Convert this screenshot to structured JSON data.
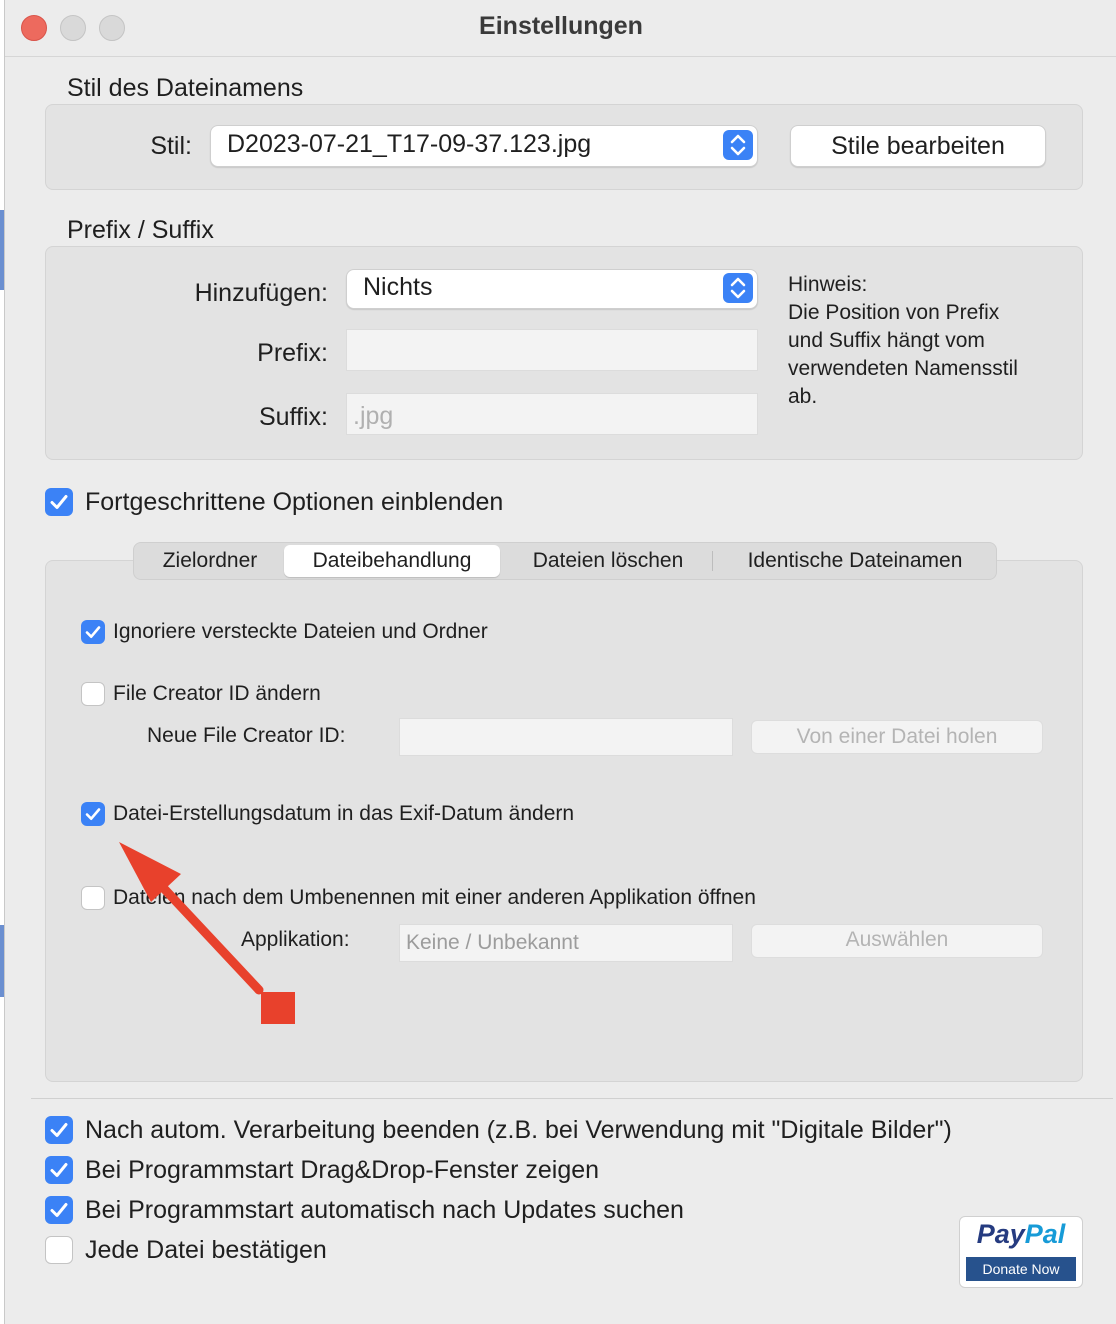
{
  "window": {
    "title": "Einstellungen"
  },
  "style_section": {
    "title": "Stil des Dateinamens",
    "label": "Stil:",
    "value": "D2023-07-21_T17-09-37.123.jpg",
    "edit_button": "Stile bearbeiten"
  },
  "prefix_section": {
    "title": "Prefix / Suffix",
    "add_label": "Hinzufügen:",
    "add_value": "Nichts",
    "prefix_label": "Prefix:",
    "prefix_value": "",
    "suffix_label": "Suffix:",
    "suffix_placeholder": ".jpg",
    "hint_title": "Hinweis:",
    "hint_lines": [
      "Die Position von Prefix",
      "und Suffix hängt vom",
      "verwendeten Namensstil",
      "ab."
    ]
  },
  "advanced": {
    "label": "Fortgeschrittene Optionen einblenden",
    "checked": true
  },
  "tabs": [
    {
      "label": "Zielordner",
      "selected": false
    },
    {
      "label": "Dateibehandlung",
      "selected": true
    },
    {
      "label": "Dateien löschen",
      "selected": false
    },
    {
      "label": "Identische Dateinamen",
      "selected": false
    }
  ],
  "file_handling": {
    "ignore_hidden": {
      "label": "Ignoriere versteckte Dateien und Ordner",
      "checked": true
    },
    "creator_id": {
      "label": "File Creator ID ändern",
      "checked": false
    },
    "new_creator_label": "Neue File Creator ID:",
    "new_creator_value": "",
    "from_file_button": "Von einer Datei holen",
    "exif_date": {
      "label": "Datei-Erstellungsdatum in das Exif-Datum ändern",
      "checked": true
    },
    "open_with": {
      "label": "Dateien nach dem Umbenennen mit einer anderen Applikation öffnen",
      "checked": false
    },
    "app_label": "Applikation:",
    "app_value": "Keine / Unbekannt",
    "choose_button": "Auswählen"
  },
  "bottom_options": [
    {
      "label": "Nach autom. Verarbeitung beenden (z.B. bei Verwendung mit \"Digitale Bilder\")",
      "checked": true
    },
    {
      "label": "Bei Programmstart Drag&Drop-Fenster zeigen",
      "checked": true
    },
    {
      "label": "Bei Programmstart automatisch nach Updates suchen",
      "checked": true
    },
    {
      "label": "Jede Datei bestätigen",
      "checked": false
    }
  ],
  "paypal": {
    "logo_pay": "Pay",
    "logo_pal": "Pal",
    "button": "Donate Now"
  },
  "colors": {
    "accent": "#3b82f6",
    "annotation_arrow": "#e8412c"
  },
  "icons": {
    "stepper": "chevron-up-down-icon",
    "checkmark": "checkmark-icon"
  }
}
